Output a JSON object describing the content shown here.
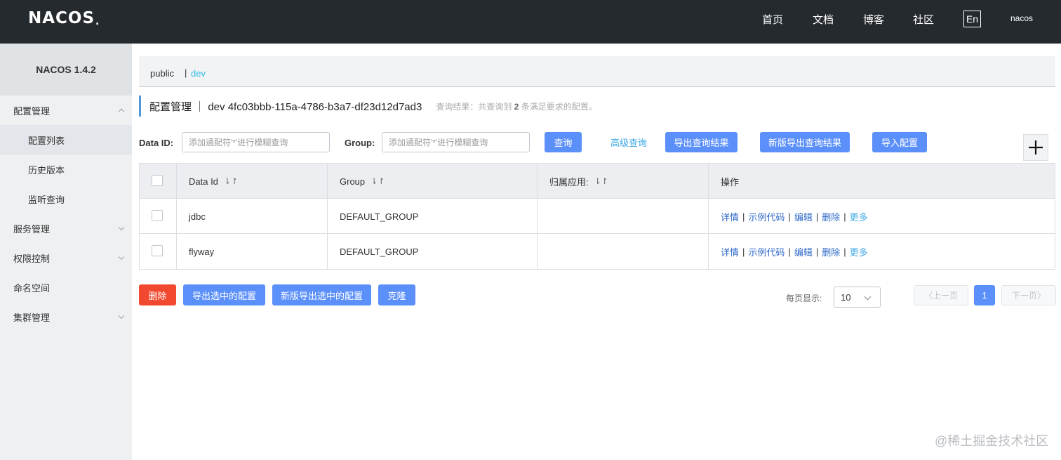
{
  "header": {
    "logo": "NACOS",
    "logo_dot": ".",
    "nav": [
      "首页",
      "文档",
      "博客",
      "社区"
    ],
    "lang": "En",
    "user": "nacos"
  },
  "sidebar": {
    "title": "NACOS 1.4.2",
    "items": [
      {
        "label": "配置管理",
        "level": "top",
        "expanded": true
      },
      {
        "label": "配置列表",
        "level": "sub",
        "active": true
      },
      {
        "label": "历史版本",
        "level": "sub"
      },
      {
        "label": "监听查询",
        "level": "sub"
      },
      {
        "label": "服务管理",
        "level": "top",
        "expanded": false
      },
      {
        "label": "权限控制",
        "level": "top",
        "expanded": false
      },
      {
        "label": "命名空间",
        "level": "top"
      },
      {
        "label": "集群管理",
        "level": "top",
        "expanded": false
      }
    ]
  },
  "namespace": {
    "public": "public",
    "separator": "|",
    "dev": "dev"
  },
  "page": {
    "title": "配置管理 ｜ dev  4fc03bbb-115a-4786-b3a7-df23d12d7ad3",
    "info_prefix": "查询结果：共查询到 ",
    "info_count": "2",
    "info_suffix": " 条满足要求的配置。"
  },
  "search": {
    "data_id_label": "Data ID:",
    "data_id_placeholder": "添加通配符'*'进行模糊查询",
    "group_label": "Group:",
    "group_placeholder": "添加通配符'*'进行模糊查询",
    "query": "查询",
    "advanced": "高级查询",
    "export": "导出查询结果",
    "export_new": "新版导出查询结果",
    "import": "导入配置"
  },
  "table": {
    "headers": [
      "Data Id",
      "Group",
      "归属应用:",
      "操作"
    ],
    "sort_glyph": "⇂↾",
    "rows": [
      {
        "data_id": "jdbc",
        "group": "DEFAULT_GROUP",
        "app": ""
      },
      {
        "data_id": "flyway",
        "group": "DEFAULT_GROUP",
        "app": ""
      }
    ],
    "ops": [
      "详情",
      "示例代码",
      "编辑",
      "删除",
      "更多"
    ],
    "op_sep": "|"
  },
  "actions": {
    "delete": "删除",
    "export_selected": "导出选中的配置",
    "export_selected_new": "新版导出选中的配置",
    "clone": "克隆"
  },
  "pagination": {
    "page_size_label": "每页显示:",
    "page_size": "10",
    "prev": "上一页",
    "current": "1",
    "next": "下一页"
  },
  "watermark": "@稀土掘金技术社区"
}
